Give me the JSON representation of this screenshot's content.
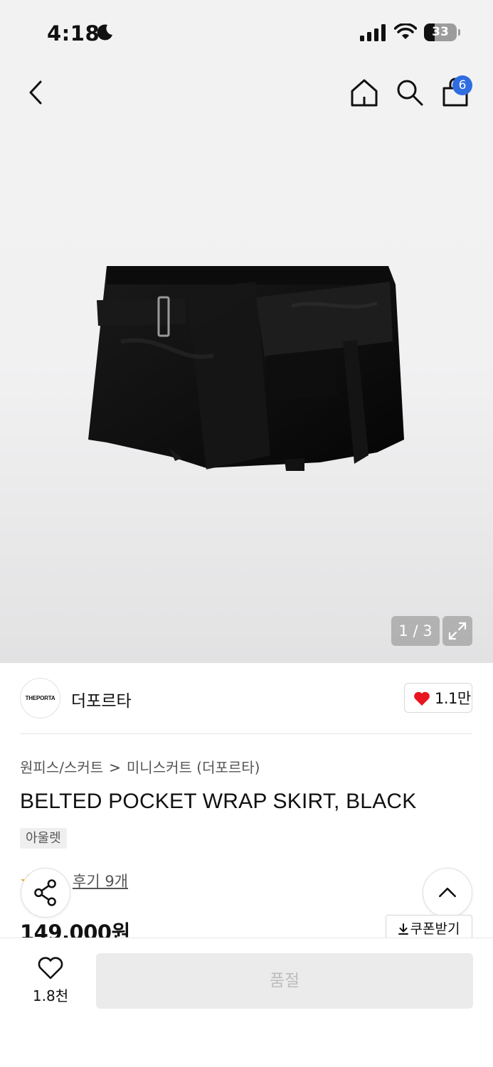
{
  "status_bar": {
    "time": "4:18",
    "battery_level": "33",
    "battery_fraction": 0.33,
    "icons": [
      "moon-icon",
      "cellular-signal-icon",
      "wifi-icon",
      "battery-icon"
    ]
  },
  "top_nav": {
    "icons": [
      "chevron-left-icon",
      "home-icon",
      "search-icon",
      "shopping-bag-icon"
    ],
    "cart_count": "6",
    "cart_badge_color": "#2f6de1"
  },
  "gallery": {
    "page_counter": "1 / 3",
    "current_page": 1,
    "total_pages": 3,
    "expand_icon": "expand-icon"
  },
  "brand": {
    "logo_text": "THEPORTA",
    "name": "더포르타",
    "like_count": "1.1만",
    "heart_color": "#e8141f"
  },
  "breadcrumb": {
    "category": "원피스/스커트",
    "separator": ">",
    "subcategory": "미니스커트 (더포르타)"
  },
  "product": {
    "title": "BELTED POCKET WRAP SKIRT, BLACK",
    "tag": "아울렛",
    "review_text": "후기 9개",
    "price": "149,000원",
    "coupon_label": "쿠폰받기"
  },
  "bottom_bar": {
    "wish_count": "1.8천",
    "soldout_label": "품절"
  },
  "colors": {
    "accent_blue": "#2f6de1",
    "heart_red": "#e8141f",
    "rating_star": "#f5a623"
  }
}
